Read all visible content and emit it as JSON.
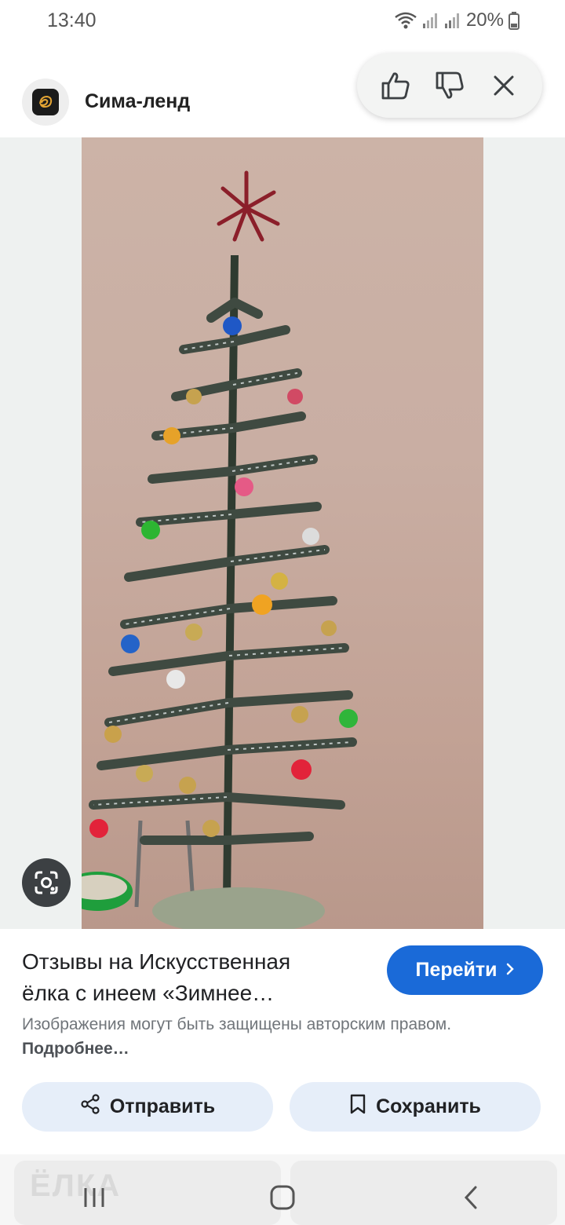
{
  "status": {
    "time": "13:40",
    "battery": "20%",
    "icons": [
      "wifi-icon",
      "signal-icon",
      "signal-icon",
      "battery-icon"
    ]
  },
  "header": {
    "site_name": "Сима-ленд",
    "logo_icon": "sima-land-logo"
  },
  "feedback": {
    "icons": [
      "thumbs-up-icon",
      "thumbs-down-icon",
      "close-icon"
    ]
  },
  "image": {
    "subject": "artificial-christmas-tree"
  },
  "result": {
    "title_line1": "Отзывы на Искусственная",
    "title_line2": "ёлка с инеем «Зимнее…",
    "goto_label": "Перейти",
    "copyright_text": "Изображения могут быть защищены авторским правом.",
    "copyright_more": "Подробнее…"
  },
  "actions": {
    "share_label": "Отправить",
    "save_label": "Сохранить"
  },
  "related": {
    "card1_text": "ЁЛКА"
  },
  "colors": {
    "accent": "#1a6ad8",
    "action_bg": "#e6eef9",
    "text": "#202124",
    "muted": "#70757a"
  }
}
